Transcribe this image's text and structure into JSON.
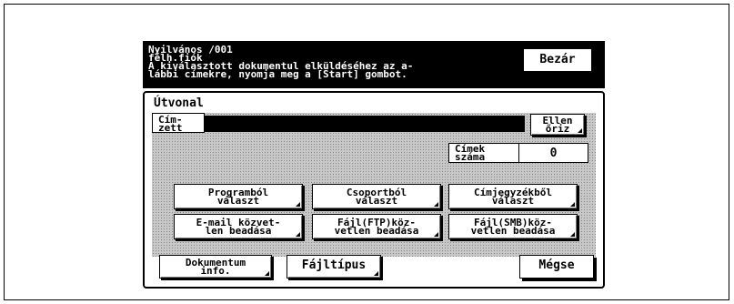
{
  "header": {
    "line1": "Nyilvános /001",
    "line2": "félh.fiók",
    "line3": "A kiválasztott dokumentul elküldéséhez az a-",
    "line4": "lábbi címekre, nyomja meg a [Start] gombot.",
    "close_label": "Bezár"
  },
  "route": {
    "title": "Útvonal",
    "recipient_label": "Cím-\nzett",
    "check_label": "Ellen\nőriz",
    "count_label": "Címek\nszáma",
    "count_value": "0"
  },
  "selection_buttons": [
    "Programból\nválaszt",
    "Csoportból\nválaszt",
    "Címjegyzékből\nválaszt",
    "E-mail közvet-\nlen beadása",
    "Fájl(FTP)köz-\nvetlen beadása",
    "Fájl(SMB)köz-\nvetlen beadása"
  ],
  "footer": {
    "doc_info_label": "Dokumentum\ninfo.",
    "file_type_label": "Fájltípus",
    "cancel_label": "Mégse"
  }
}
